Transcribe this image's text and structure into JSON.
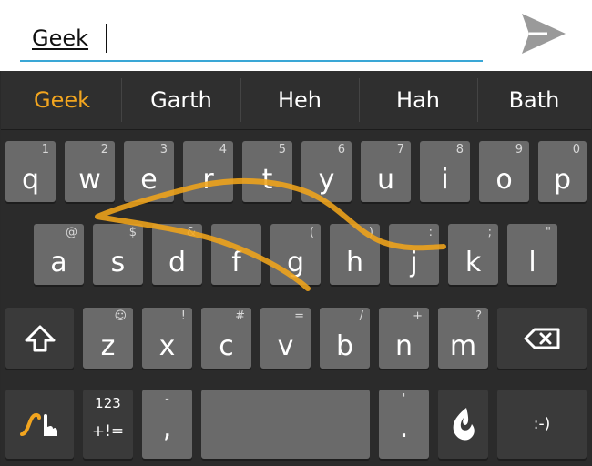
{
  "input": {
    "value": "Geek"
  },
  "suggestions": [
    {
      "label": "Geek",
      "primary": true
    },
    {
      "label": "Garth",
      "primary": false
    },
    {
      "label": "Heh",
      "primary": false
    },
    {
      "label": "Hah",
      "primary": false
    },
    {
      "label": "Bath",
      "primary": false
    }
  ],
  "rows": {
    "row1": [
      {
        "label": "q",
        "hint": "1"
      },
      {
        "label": "w",
        "hint": "2"
      },
      {
        "label": "e",
        "hint": "3"
      },
      {
        "label": "r",
        "hint": "4"
      },
      {
        "label": "t",
        "hint": "5"
      },
      {
        "label": "y",
        "hint": "6"
      },
      {
        "label": "u",
        "hint": "7"
      },
      {
        "label": "i",
        "hint": "8"
      },
      {
        "label": "o",
        "hint": "9"
      },
      {
        "label": "p",
        "hint": "0"
      }
    ],
    "row2": [
      {
        "label": "a",
        "hint": "@"
      },
      {
        "label": "s",
        "hint": "$"
      },
      {
        "label": "d",
        "hint": "&"
      },
      {
        "label": "f",
        "hint": "_"
      },
      {
        "label": "g",
        "hint": "("
      },
      {
        "label": "h",
        "hint": ")"
      },
      {
        "label": "j",
        "hint": ":"
      },
      {
        "label": "k",
        "hint": ";"
      },
      {
        "label": "l",
        "hint": "\""
      }
    ],
    "row3": [
      {
        "label": "z",
        "hint": "☺"
      },
      {
        "label": "x",
        "hint": "!"
      },
      {
        "label": "c",
        "hint": "#"
      },
      {
        "label": "v",
        "hint": "="
      },
      {
        "label": "b",
        "hint": "/"
      },
      {
        "label": "n",
        "hint": "+"
      },
      {
        "label": "m",
        "hint": "?"
      }
    ]
  },
  "bottom": {
    "sym_top": "123",
    "sym_bottom": "+!=",
    "comma": ",",
    "comma_hint": "-",
    "period": ".",
    "period_hint": "'",
    "smiley": ":-)"
  },
  "icons": {
    "send": "send-icon",
    "shift": "shift-icon",
    "backspace": "backspace-icon",
    "swype": "swype-icon",
    "dragon": "dragon-mic-icon"
  },
  "colors": {
    "accent": "#f2a51f",
    "input_underline": "#3aa7d6",
    "key": "#6a6a6a",
    "key_dark": "#3a3a3a",
    "keyboard_bg": "#2b2b2b",
    "send_icon": "#9a9a9a"
  }
}
